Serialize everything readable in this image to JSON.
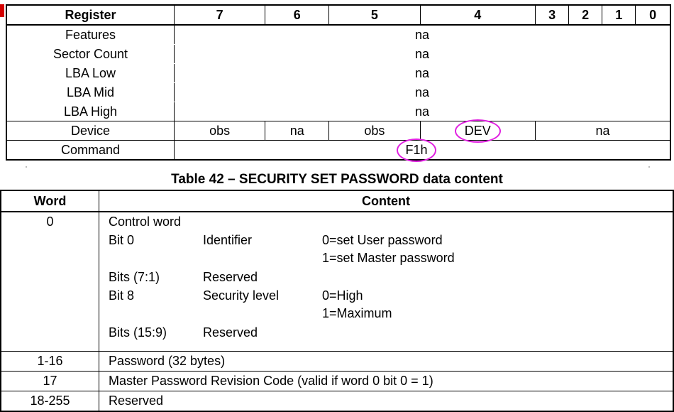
{
  "register_table": {
    "header": [
      "Register",
      "7",
      "6",
      "5",
      "4",
      "3",
      "2",
      "1",
      "0"
    ],
    "rows": [
      {
        "name": "Features",
        "value": "na"
      },
      {
        "name": "Sector Count",
        "value": "na"
      },
      {
        "name": "LBA Low",
        "value": "na"
      },
      {
        "name": "LBA Mid",
        "value": "na"
      },
      {
        "name": "LBA High",
        "value": "na"
      }
    ],
    "device": {
      "name": "Device",
      "bit7": "obs",
      "bit6": "na",
      "bit5": "obs",
      "bit4": "DEV",
      "bits3_0": "na"
    },
    "command": {
      "name": "Command",
      "value": "F1h"
    },
    "highlight_color": "#e020e0"
  },
  "caption": "Table 42 – SECURITY SET PASSWORD data content",
  "data_table": {
    "header": {
      "word": "Word",
      "content": "Content"
    },
    "control_word": {
      "word": "0",
      "title": "Control word",
      "bit0_label": "Bit 0",
      "bit0_field": "Identifier",
      "bit0_val0": "0=set User password",
      "bit0_val1": "1=set Master password",
      "bits71_label": "Bits (7:1)",
      "bits71_field": "Reserved",
      "bit8_label": "Bit 8",
      "bit8_field": "Security level",
      "bit8_val0": "0=High",
      "bit8_val1": "1=Maximum",
      "bits159_label": "Bits (15:9)",
      "bits159_field": "Reserved"
    },
    "rows": [
      {
        "word": "1-16",
        "content": "Password (32 bytes)"
      },
      {
        "word": "17",
        "content": "Master Password Revision Code (valid if word 0 bit 0 = 1)"
      },
      {
        "word": "18-255",
        "content": "Reserved"
      }
    ]
  }
}
